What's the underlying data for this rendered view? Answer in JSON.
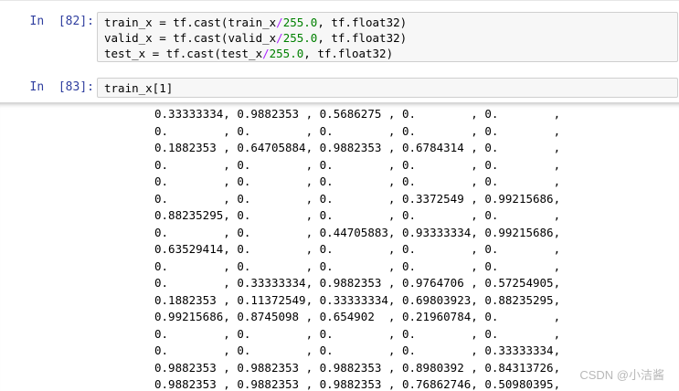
{
  "cells": [
    {
      "prompt": "In  [82]:",
      "lines": [
        {
          "pre": "train_x = tf.cast(train_x",
          "op": "/",
          "num": "255.0",
          "post": ", tf.float32)"
        },
        {
          "pre": "valid_x = tf.cast(valid_x",
          "op": "/",
          "num": "255.0",
          "post": ", tf.float32)"
        },
        {
          "pre": "test_x = tf.cast(test_x",
          "op": "/",
          "num": "255.0",
          "post": ", tf.float32)"
        }
      ]
    },
    {
      "prompt": "In  [83]:",
      "lines": [
        {
          "pre": "train_x[",
          "op": "",
          "num": "1",
          "post": "]"
        }
      ]
    }
  ],
  "output": {
    "rows": [
      [
        "0.33333334,",
        "0.9882353 ,",
        "0.5686275 ,",
        "0.        ,",
        "0.        ,"
      ],
      [
        "0.        ,",
        "0.        ,",
        "0.        ,",
        "0.        ,",
        "0.        ,"
      ],
      [
        "0.1882353 ,",
        "0.64705884,",
        "0.9882353 ,",
        "0.6784314 ,",
        "0.        ,"
      ],
      [
        "0.        ,",
        "0.        ,",
        "0.        ,",
        "0.        ,",
        "0.        ,"
      ],
      [
        "0.        ,",
        "0.        ,",
        "0.        ,",
        "0.        ,",
        "0.        ,"
      ],
      [
        "0.        ,",
        "0.        ,",
        "0.        ,",
        "0.3372549 ,",
        "0.99215686,"
      ],
      [
        "0.88235295,",
        "0.        ,",
        "0.        ,",
        "0.        ,",
        "0.        ,"
      ],
      [
        "0.        ,",
        "0.        ,",
        "0.44705883,",
        "0.93333334,",
        "0.99215686,"
      ],
      [
        "0.63529414,",
        "0.        ,",
        "0.        ,",
        "0.        ,",
        "0.        ,"
      ],
      [
        "0.        ,",
        "0.        ,",
        "0.        ,",
        "0.        ,",
        "0.        ,"
      ],
      [
        "0.        ,",
        "0.33333334,",
        "0.9882353 ,",
        "0.9764706 ,",
        "0.57254905,"
      ],
      [
        "0.1882353 ,",
        "0.11372549,",
        "0.33333334,",
        "0.69803923,",
        "0.88235295,"
      ],
      [
        "0.99215686,",
        "0.8745098 ,",
        "0.654902  ,",
        "0.21960784,",
        "0.        ,"
      ],
      [
        "0.        ,",
        "0.        ,",
        "0.        ,",
        "0.        ,",
        "0.        ,"
      ],
      [
        "0.        ,",
        "0.        ,",
        "0.        ,",
        "0.        ,",
        "0.33333334,"
      ],
      [
        "0.9882353 ,",
        "0.9882353 ,",
        "0.9882353 ,",
        "0.8980392 ,",
        "0.84313726,"
      ],
      [
        "0.9882353 ,",
        "0.9882353 ,",
        "0.9882353 ,",
        "0.76862746,",
        "0.50980395,"
      ]
    ]
  },
  "watermark": "CSDN @小洁酱",
  "colors": {
    "prompt": "#303f9f",
    "number": "#008000",
    "operator": "#aa22ff",
    "input_bg": "#f7f7f7"
  }
}
